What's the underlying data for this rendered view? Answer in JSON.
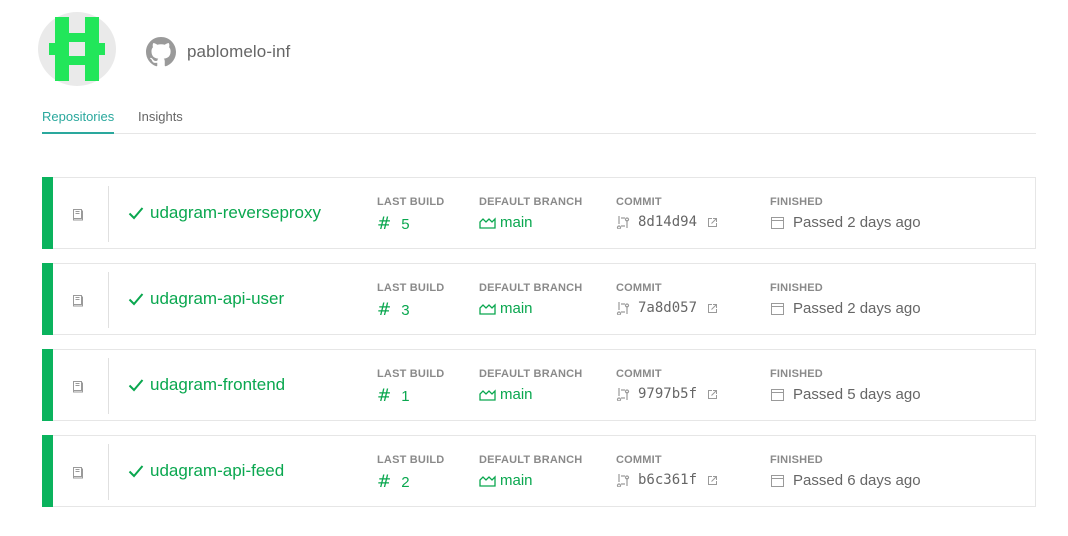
{
  "owner": {
    "name": "pablomelo-inf",
    "avatar_color": "#22e65a"
  },
  "tabs": [
    {
      "label": "Repositories",
      "active": true
    },
    {
      "label": "Insights",
      "active": false
    }
  ],
  "columns": {
    "last_build": "LAST BUILD",
    "default_branch": "DEFAULT BRANCH",
    "commit": "COMMIT",
    "finished": "FINISHED"
  },
  "colors": {
    "passed": "#0ab35d",
    "accent": "#2aa89d"
  },
  "repos": [
    {
      "name": "udagram-reverseproxy",
      "build_symbol": "#",
      "build": "5",
      "branch": "main",
      "commit": "8d14d94",
      "finished": "Passed 2 days ago",
      "status": "passed"
    },
    {
      "name": "udagram-api-user",
      "build_symbol": "#",
      "build": "3",
      "branch": "main",
      "commit": "7a8d057",
      "finished": "Passed 2 days ago",
      "status": "passed"
    },
    {
      "name": "udagram-frontend",
      "build_symbol": "#",
      "build": "1",
      "branch": "main",
      "commit": "9797b5f",
      "finished": "Passed 5 days ago",
      "status": "passed"
    },
    {
      "name": "udagram-api-feed",
      "build_symbol": "#",
      "build": "2",
      "branch": "main",
      "commit": "b6c361f",
      "finished": "Passed 6 days ago",
      "status": "passed"
    }
  ]
}
